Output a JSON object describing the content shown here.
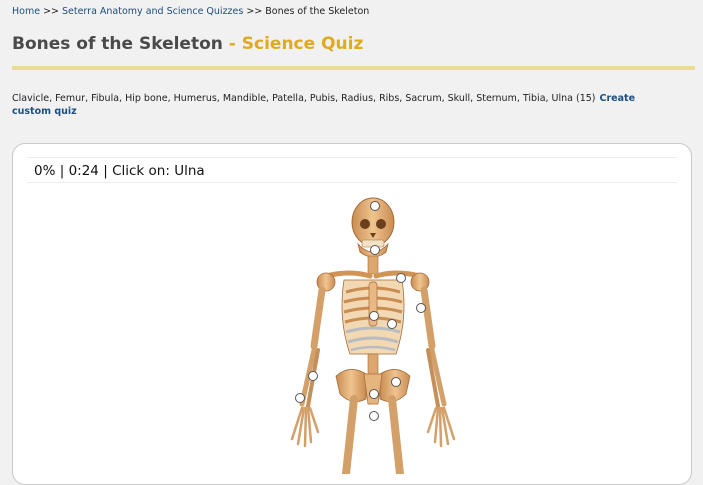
{
  "breadcrumb": {
    "items": [
      {
        "label": "Home"
      },
      {
        "label": "Seterra Anatomy and Science Quizzes"
      },
      {
        "label": "Bones of the Skeleton"
      }
    ],
    "separator": ">>"
  },
  "page": {
    "title_main": "Bones of the Skeleton",
    "title_accent": "- Science Quiz"
  },
  "bone_list": {
    "text": "Clavicle, Femur, Fibula, Hip bone, Humerus, Mandible, Patella, Pubis, Radius, Ribs, Sacrum, Skull, Sternum, Tibia, Ulna (15)",
    "custom_link": "Create custom quiz"
  },
  "quiz": {
    "percent": "0%",
    "timer": "0:24",
    "prompt_label": "Click on:",
    "target": "Ulna",
    "divider": "|"
  },
  "colors": {
    "link": "#1d4f7d",
    "accent": "#e0aa1c",
    "rule": "#ebdc95",
    "bone": "#d9a26b"
  }
}
